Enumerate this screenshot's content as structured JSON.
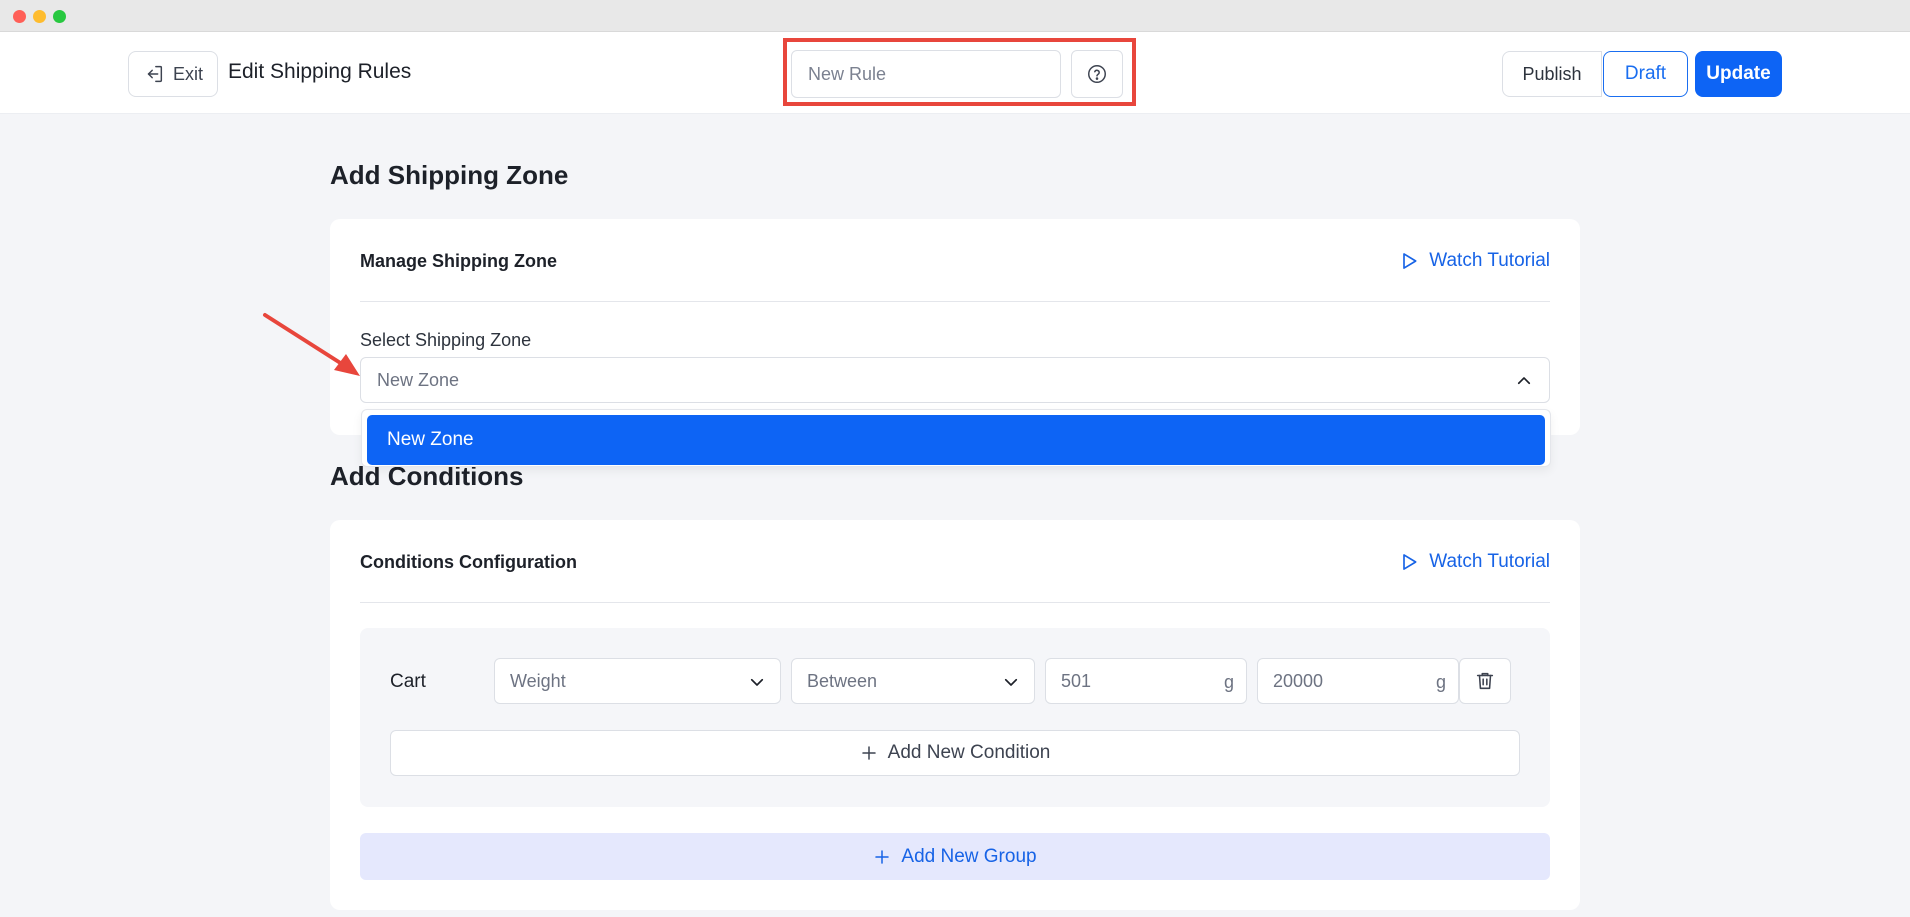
{
  "window": {
    "controls": [
      "close",
      "minimize",
      "maximize"
    ]
  },
  "header": {
    "exit_label": "Exit",
    "title": "Edit Shipping Rules",
    "rule_name_placeholder": "New Rule",
    "publish_label": "Publish",
    "draft_label": "Draft",
    "update_label": "Update"
  },
  "shipping_zone": {
    "section_title": "Add Shipping Zone",
    "card_title": "Manage Shipping Zone",
    "tutorial_label": "Watch Tutorial",
    "select_label": "Select Shipping Zone",
    "select_value": "New Zone",
    "options": [
      "New Zone"
    ]
  },
  "conditions": {
    "section_title": "Add Conditions",
    "card_title": "Conditions Configuration",
    "tutorial_label": "Watch Tutorial",
    "row": {
      "label": "Cart",
      "attribute": "Weight",
      "operator": "Between",
      "min_value": "501",
      "min_unit": "g",
      "max_value": "20000",
      "max_unit": "g"
    },
    "add_condition_label": "Add New Condition",
    "add_group_label": "Add New Group"
  },
  "colors": {
    "primary": "#0d64f5",
    "link": "#1763e6",
    "highlight": "#e8463c",
    "page_bg": "#f4f5f8"
  }
}
